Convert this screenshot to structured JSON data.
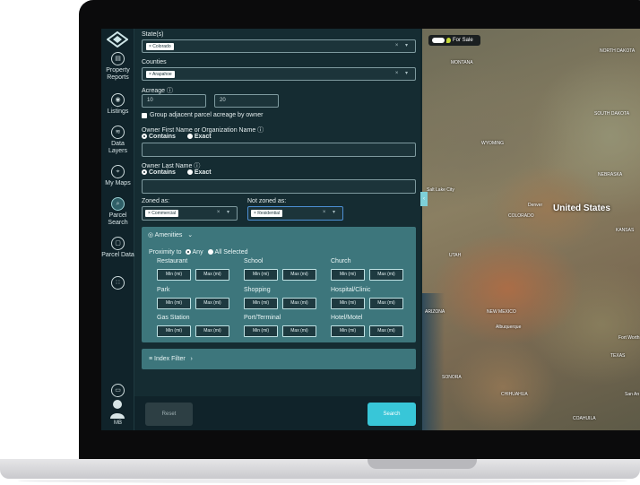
{
  "nav": {
    "items": [
      {
        "name": "property-reports",
        "label": "Property Reports"
      },
      {
        "name": "listings",
        "label": "Listings"
      },
      {
        "name": "data-layers",
        "label": "Data Layers"
      },
      {
        "name": "my-maps",
        "label": "My Maps"
      },
      {
        "name": "parcel-search",
        "label": "Parcel Search"
      },
      {
        "name": "parcel-data",
        "label": "Parcel Data"
      }
    ],
    "user_initials": "MB"
  },
  "filters": {
    "states_label": "State(s)",
    "states_chip": "× Colorado",
    "counties_label": "Counties",
    "counties_chip": "× Arapahoe",
    "acreage_label": "Acreage",
    "acreage_min": "10",
    "acreage_max": "20",
    "group_adjacent_label": "Group adjacent parcel acreage by owner",
    "owner_first_label": "Owner First Name or Organization Name",
    "owner_last_label": "Owner Last Name",
    "contains_label": "Contains",
    "exact_label": "Exact",
    "zoned_as_label": "Zoned as:",
    "zoned_as_chip": "× Commercial",
    "not_zoned_as_label": "Not zoned as:",
    "not_zoned_as_chip": "× Residential"
  },
  "amenities": {
    "header": "Amenities",
    "proximity_label": "Proximity to",
    "any_label": "Any",
    "all_selected_label": "All Selected",
    "min_placeholder": "Min (mi)",
    "max_placeholder": "Max (mi)",
    "categories": [
      "Restaurant",
      "School",
      "Church",
      "Park",
      "Shopping",
      "Hospital/Clinic",
      "Gas Station",
      "Port/Terminal",
      "Hotel/Motel"
    ]
  },
  "index_filter": {
    "label": "Index Filter"
  },
  "footer": {
    "reset_label": "Reset",
    "search_label": "Search"
  },
  "map": {
    "for_sale_label": "For Sale",
    "country_label": "United States",
    "labels": {
      "montana": "MONTANA",
      "north_dakota": "NORTH DAKOTA",
      "south_dakota": "SOUTH DAKOTA",
      "wyoming": "WYOMING",
      "nebraska": "NEBRASKA",
      "kansas": "KANSAS",
      "colorado": "COLORADO",
      "utah": "UTAH",
      "arizona": "ARIZONA",
      "new_mexico": "NEW MEXICO",
      "texas": "TEXAS",
      "sonora": "SONORA",
      "chihuahua": "CHIHUAHUA",
      "coahuila": "COAHUILA",
      "denver": "Denver",
      "salt_lake_city": "Salt Lake City",
      "albuquerque": "Albuquerque",
      "fort_worth": "Fort Worth",
      "san_antonio": "San An"
    }
  }
}
